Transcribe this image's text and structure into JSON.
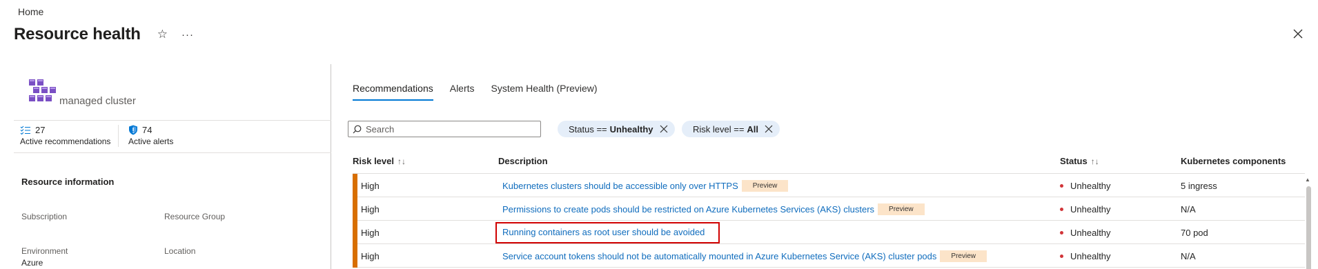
{
  "breadcrumb": {
    "home": "Home"
  },
  "header": {
    "title": "Resource health",
    "more": "···"
  },
  "resource": {
    "name": "managed cluster",
    "stats": [
      {
        "value": "27",
        "label": "Active recommendations",
        "icon": "checklist-icon"
      },
      {
        "value": "74",
        "label": "Active alerts",
        "icon": "shield-icon"
      }
    ]
  },
  "resource_info": {
    "title": "Resource information",
    "fields": [
      {
        "label": "Subscription",
        "value": ""
      },
      {
        "label": "Resource Group",
        "value": ""
      },
      {
        "label": "Environment",
        "value": "Azure"
      },
      {
        "label": "Location",
        "value": ""
      }
    ]
  },
  "tabs": [
    {
      "label": "Recommendations",
      "active": true
    },
    {
      "label": "Alerts",
      "active": false
    },
    {
      "label": "System Health (Preview)",
      "active": false
    }
  ],
  "search": {
    "placeholder": "Search",
    "value": ""
  },
  "filters": [
    {
      "field": "Status ==",
      "value": "Unhealthy"
    },
    {
      "field": "Risk level ==",
      "value": "All"
    }
  ],
  "table": {
    "columns": [
      "Risk level",
      "Description",
      "Status",
      "Kubernetes components"
    ],
    "sort_icons": {
      "risk": "↑↓",
      "status": "↑↓"
    },
    "preview_label": "Preview",
    "rows": [
      {
        "risk": "High",
        "description": "Kubernetes clusters should be accessible only over HTTPS",
        "preview": true,
        "status": "Unhealthy",
        "components": "5 ingress"
      },
      {
        "risk": "High",
        "description": "Permissions to create pods should be restricted on Azure Kubernetes Services (AKS) clusters",
        "preview": true,
        "status": "Unhealthy",
        "components": "N/A"
      },
      {
        "risk": "High",
        "description": "Running containers as root user should be avoided",
        "preview": false,
        "status": "Unhealthy",
        "components": "70 pod"
      },
      {
        "risk": "High",
        "description": "Service account tokens should not be automatically mounted in Azure Kubernetes Service (AKS) cluster pods",
        "preview": true,
        "status": "Unhealthy",
        "components": "N/A"
      }
    ]
  },
  "colors": {
    "accent": "#0078d4",
    "link": "#0f6cbd",
    "risk_high": "#d86f00",
    "unhealthy": "#d13438",
    "highlight": "#d00000",
    "preview_bg": "#fce4c9",
    "pill_bg": "#e5eef9"
  }
}
